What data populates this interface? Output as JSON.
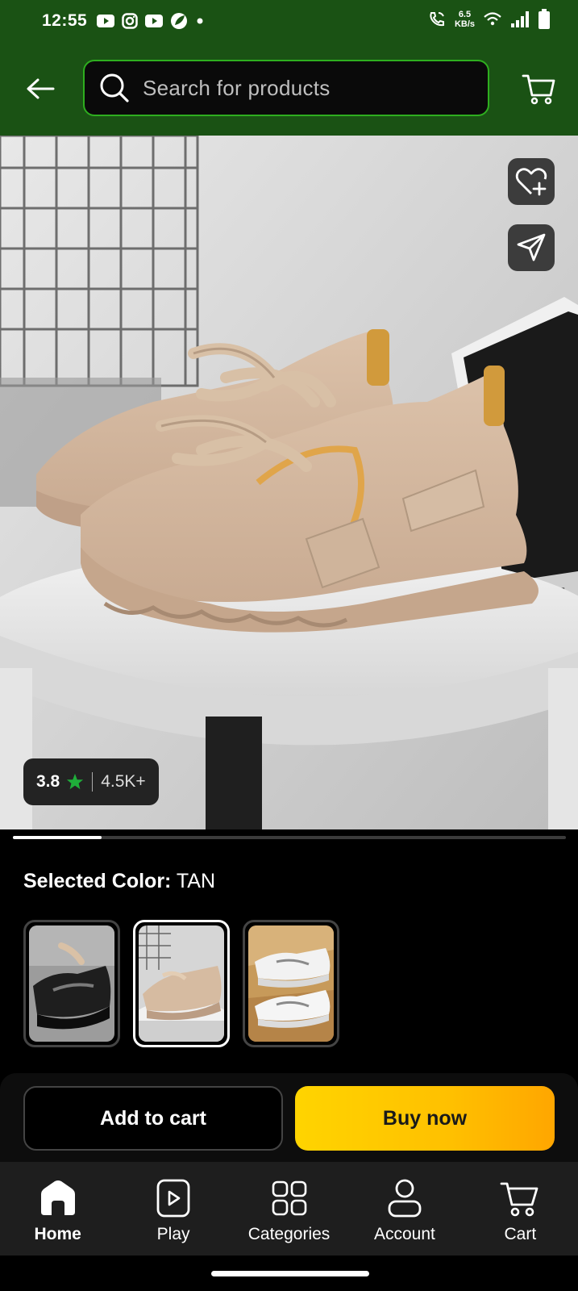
{
  "status_bar": {
    "time": "12:55",
    "speed_value": "6.5",
    "speed_unit": "KB/s",
    "app_icons": [
      "youtube-icon",
      "instagram-icon",
      "youtube-icon",
      "leaf-app-icon",
      "dot-icon"
    ],
    "system_icons": [
      "call-wifi-icon",
      "wifi-icon",
      "signal-icon",
      "battery-icon"
    ]
  },
  "header": {
    "search_placeholder": "Search for products",
    "accent_color": "#1a5214",
    "search_border_color": "#2eae1f"
  },
  "product": {
    "rating": "3.8",
    "rating_count": "4.5K+",
    "image_progress": 0.16,
    "selected_color_label": "Selected Color:",
    "selected_color_value": "TAN",
    "swatches": [
      {
        "name": "black",
        "selected": false
      },
      {
        "name": "tan",
        "selected": true
      },
      {
        "name": "white",
        "selected": false
      }
    ]
  },
  "actions": {
    "add_to_cart": "Add to cart",
    "buy_now": "Buy now",
    "buy_now_color": "#ffc000"
  },
  "nav": {
    "items": [
      {
        "label": "Home",
        "icon": "home-icon",
        "active": true
      },
      {
        "label": "Play",
        "icon": "play-icon",
        "active": false
      },
      {
        "label": "Categories",
        "icon": "categories-icon",
        "active": false
      },
      {
        "label": "Account",
        "icon": "account-icon",
        "active": false
      },
      {
        "label": "Cart",
        "icon": "cart-icon",
        "active": false
      }
    ]
  }
}
